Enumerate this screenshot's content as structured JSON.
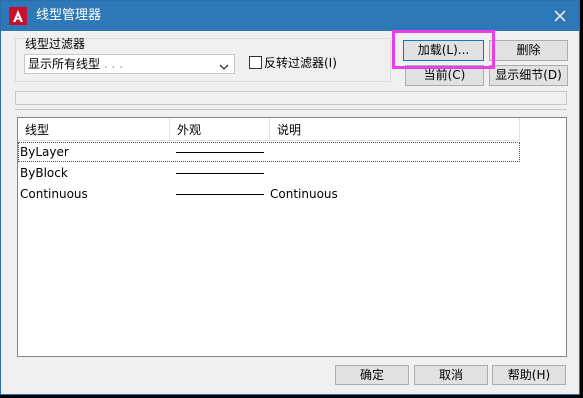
{
  "window": {
    "title": "线型管理器",
    "title_bar_color": "#2f78b8",
    "app_icon": "autocad-icon",
    "close_icon": "close-icon"
  },
  "filter": {
    "group_label": "线型过滤器",
    "selected_option": "显示所有线型",
    "selected_option_suffix": ". . .",
    "invert_label": "反转过滤器(I)",
    "invert_checked": false
  },
  "buttons": {
    "load": "加载(L)...",
    "delete": "删除",
    "current": "当前(C)",
    "show_details": "显示细节(D)",
    "ok": "确定",
    "cancel": "取消",
    "help": "帮助(H)"
  },
  "highlight_color": "#e83fe8",
  "table": {
    "columns": [
      "线型",
      "外观",
      "说明"
    ],
    "rows": [
      {
        "name": "ByLayer",
        "has_line": true,
        "description": ""
      },
      {
        "name": "ByBlock",
        "has_line": true,
        "description": ""
      },
      {
        "name": "Continuous",
        "has_line": true,
        "description": "Continuous"
      }
    ]
  }
}
